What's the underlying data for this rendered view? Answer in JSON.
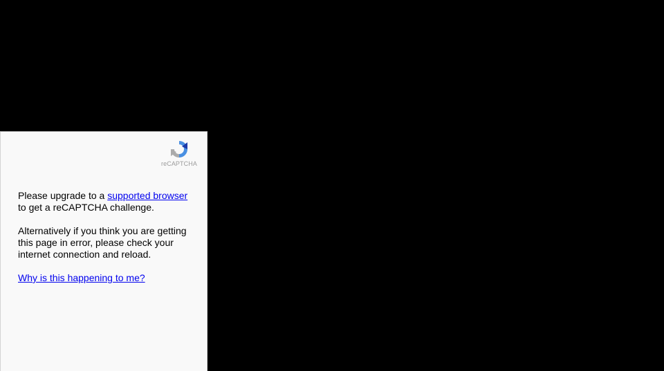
{
  "logo": {
    "label": "reCAPTCHA",
    "icon": "recaptcha-logo-icon"
  },
  "message": {
    "upgrade_prefix": "Please upgrade to a ",
    "upgrade_link": "supported browser",
    "upgrade_suffix": " to get a reCAPTCHA challenge.",
    "alternative": "Alternatively if you think you are getting this page in error, please check your internet connection and reload.",
    "why_link": "Why is this happening to me?"
  },
  "colors": {
    "background": "#000000",
    "frame": "#f9f9f9",
    "link": "#0000ee"
  }
}
